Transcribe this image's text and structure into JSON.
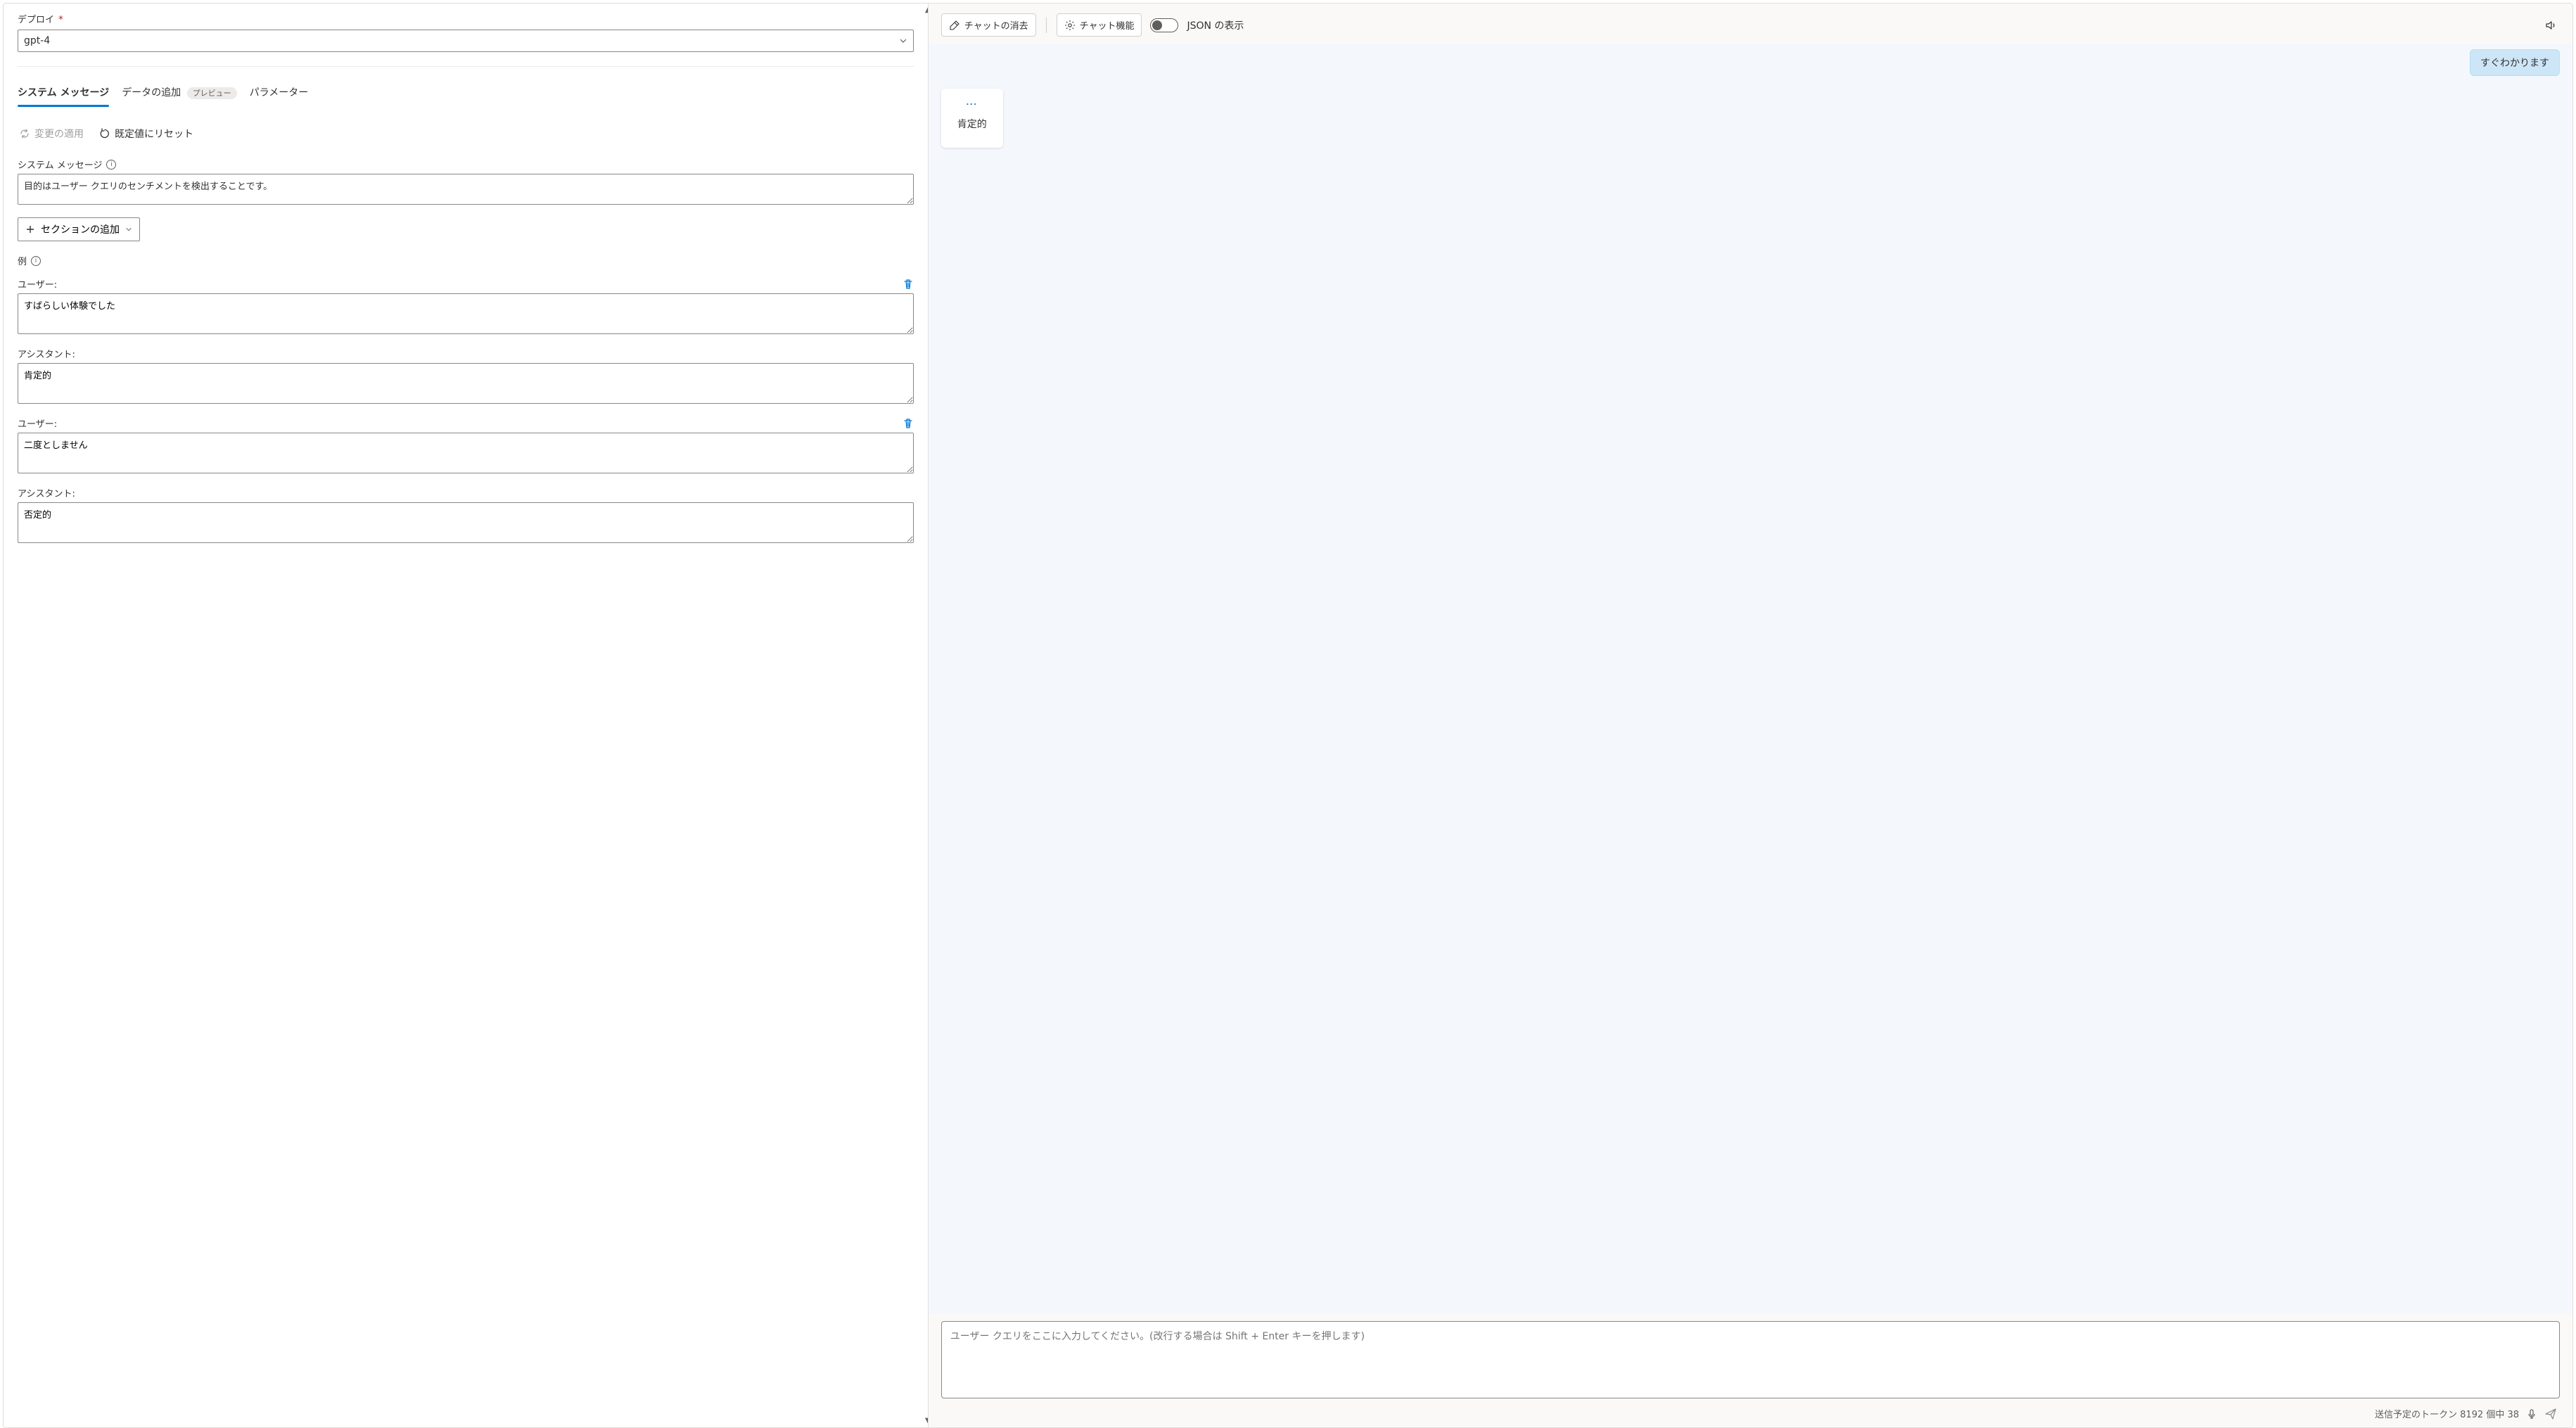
{
  "leftPanel": {
    "deployLabel": "デプロイ",
    "deployValue": "gpt-4",
    "tabs": {
      "systemMessage": "システム メッセージ",
      "dataAdd": "データの追加",
      "previewBadge": "プレビュー",
      "parameters": "パラメーター"
    },
    "actions": {
      "applyChanges": "変更の適用",
      "resetDefault": "既定値にリセット"
    },
    "systemMessageLabel": "システム メッセージ",
    "systemMessageValue": "目的はユーザー クエリのセンチメントを検出することです。",
    "addSection": "セクションの追加",
    "examplesLabel": "例",
    "examples": [
      {
        "userLabel": "ユーザー:",
        "userValue": "すばらしい体験でした",
        "assistantLabel": "アシスタント:",
        "assistantValue": "肯定的"
      },
      {
        "userLabel": "ユーザー:",
        "userValue": "二度としません",
        "assistantLabel": "アシスタント:",
        "assistantValue": "否定的"
      }
    ]
  },
  "rightPanel": {
    "toolbar": {
      "clearChat": "チャットの消去",
      "chatFeatures": "チャット機能",
      "jsonView": "JSON の表示"
    },
    "messages": {
      "userText": "すぐわかります",
      "assistantText": "肯定的"
    },
    "inputPlaceholder": "ユーザー クエリをここに入力してください。(改行する場合は Shift + Enter キーを押します)",
    "footer": {
      "tokenText": "送信予定のトークン 8192 個中 38"
    }
  }
}
